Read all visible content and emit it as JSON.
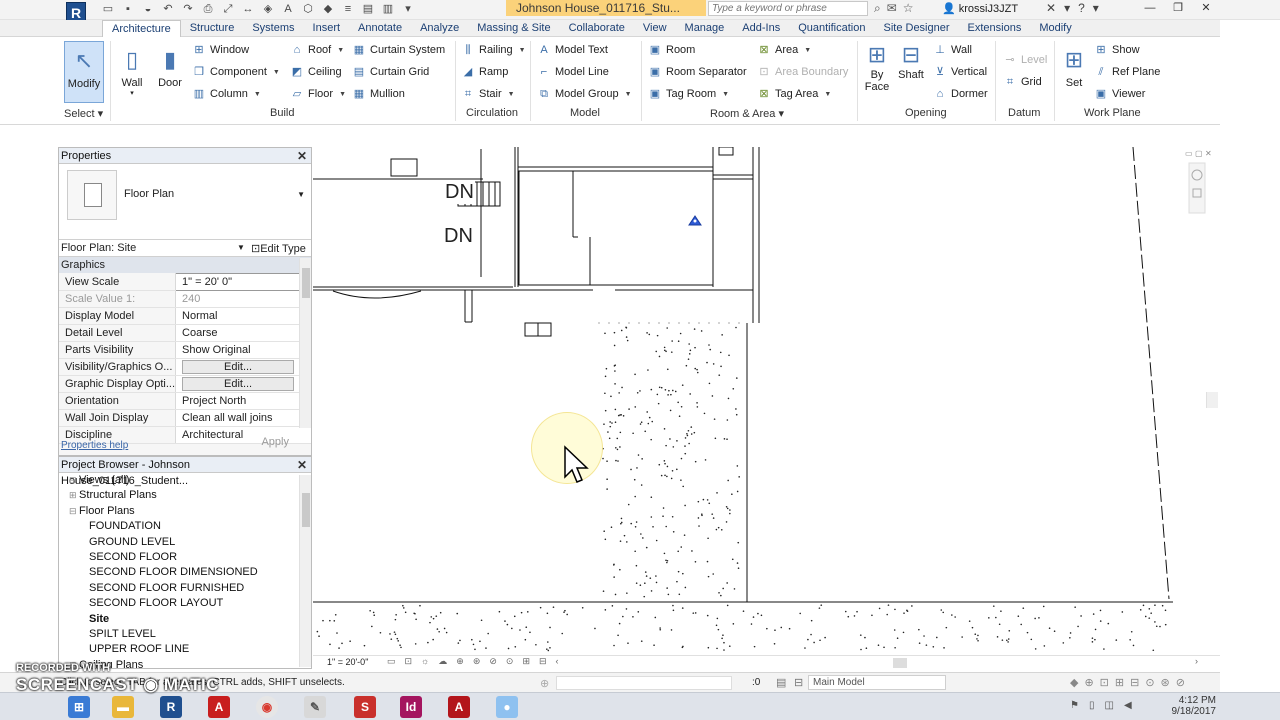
{
  "titlebar": {
    "doc_title": "Johnson House_011716_Stu...",
    "search_placeholder": "Type a keyword or phrase",
    "user": "krossiJ3JZT"
  },
  "ribbon": {
    "tabs": [
      "Architecture",
      "Structure",
      "Systems",
      "Insert",
      "Annotate",
      "Analyze",
      "Massing & Site",
      "Collaborate",
      "View",
      "Manage",
      "Add-Ins",
      "Quantification",
      "Site Designer",
      "Extensions",
      "Modify"
    ],
    "active_tab": "Architecture",
    "select": {
      "modify": "Modify",
      "label": "Select"
    },
    "build": {
      "wall": "Wall",
      "door": "Door",
      "window": "Window",
      "component": "Component",
      "column": "Column",
      "roof": "Roof",
      "ceiling": "Ceiling",
      "floor": "Floor",
      "curtain_system": "Curtain  System",
      "curtain_grid": "Curtain  Grid",
      "mullion": "Mullion",
      "label": "Build"
    },
    "circulation": {
      "railing": "Railing",
      "ramp": "Ramp",
      "stair": "Stair",
      "label": "Circulation"
    },
    "model": {
      "model_text": "Model  Text",
      "model_line": "Model  Line",
      "model_group": "Model  Group",
      "label": "Model"
    },
    "room_area": {
      "room": "Room",
      "room_separator": "Room  Separator",
      "tag_room": "Tag  Room",
      "area": "Area",
      "area_boundary": "Area  Boundary",
      "tag_area": "Tag  Area",
      "label": "Room & Area"
    },
    "opening": {
      "by_face_1": "By",
      "by_face_2": "Face",
      "shaft": "Shaft",
      "wall": "Wall",
      "vertical": "Vertical",
      "dormer": "Dormer",
      "label": "Opening"
    },
    "datum": {
      "level": "Level",
      "grid": "Grid",
      "label": "Datum"
    },
    "work_plane": {
      "set": "Set",
      "show": "Show",
      "ref_plane": "Ref  Plane",
      "viewer": "Viewer",
      "label": "Work Plane"
    }
  },
  "properties": {
    "title": "Properties",
    "type_name": "Floor Plan",
    "view_selector": "Floor Plan: Site",
    "edit_type": "Edit Type",
    "group": "Graphics",
    "rows": [
      {
        "key": "View Scale",
        "value": "1\" = 20' 0\""
      },
      {
        "key": "Scale Value    1:",
        "value": "240"
      },
      {
        "key": "Display Model",
        "value": "Normal"
      },
      {
        "key": "Detail Level",
        "value": "Coarse"
      },
      {
        "key": "Parts Visibility",
        "value": "Show Original"
      },
      {
        "key": "Visibility/Graphics O...",
        "value": "Edit..."
      },
      {
        "key": "Graphic Display Opti...",
        "value": "Edit..."
      },
      {
        "key": "Orientation",
        "value": "Project North"
      },
      {
        "key": "Wall Join Display",
        "value": "Clean all wall joins"
      },
      {
        "key": "Discipline",
        "value": "Architectural"
      }
    ],
    "help_link": "Properties help",
    "apply": "Apply"
  },
  "browser": {
    "title": "Project Browser - Johnson House_011716_Student...",
    "nodes": [
      {
        "label": "Views (all)",
        "level": 0,
        "toggle": "-"
      },
      {
        "label": "Structural Plans",
        "level": 1,
        "toggle": "+"
      },
      {
        "label": "Floor Plans",
        "level": 1,
        "toggle": "-"
      },
      {
        "label": "FOUNDATION",
        "level": 2
      },
      {
        "label": "GROUND LEVEL",
        "level": 2
      },
      {
        "label": "SECOND FLOOR",
        "level": 2
      },
      {
        "label": "SECOND FLOOR DIMENSIONED",
        "level": 2
      },
      {
        "label": "SECOND FLOOR FURNISHED",
        "level": 2
      },
      {
        "label": "SECOND FLOOR LAYOUT",
        "level": 2
      },
      {
        "label": "Site",
        "level": 2,
        "bold": true
      },
      {
        "label": "SPILT LEVEL",
        "level": 2
      },
      {
        "label": "UPPER ROOF LINE",
        "level": 2
      },
      {
        "label": "Ceiling Plans",
        "level": 1,
        "toggle": "+"
      }
    ]
  },
  "canvas": {
    "dn_label_1": "DN",
    "dn_label_2": "DN",
    "scale_label": "1\" = 20'-0\""
  },
  "status": {
    "hint": "Click to select, TAB for alternates, CTRL adds, SHIFT unselects.",
    "zero": ":0",
    "model": "Main Model"
  },
  "taskbar": {
    "time": "4:12 PM",
    "date": "9/18/2017"
  },
  "watermark": {
    "line1": "RECORDED WITH",
    "line2": "SCREENCAST",
    "line3": "MATIC"
  },
  "colors": {
    "accent": "#1b3f73",
    "doc_title_bg": "#fbd27a",
    "active_tool_bg": "#cfe2f8"
  }
}
